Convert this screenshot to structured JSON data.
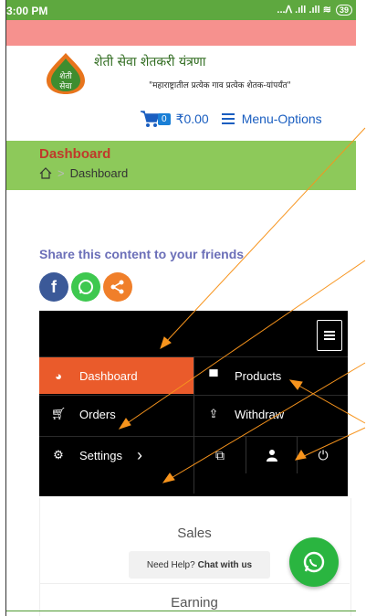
{
  "status_bar": {
    "time": "3:00 PM",
    "battery": "39",
    "signal_icons": "...ᐱ .ıll .ıll ≋"
  },
  "header": {
    "logo_text_top": "शेती",
    "logo_text_bottom": "सेवा",
    "brand": "शेती सेवा शेतकरी यंत्रणा",
    "tagline": "\"महाराष्ट्रातील प्रत्येक गाव प्रत्येक शेतक-यांपर्यंत\""
  },
  "cart": {
    "count": "0",
    "price": "₹0.00",
    "menu_label": "Menu-Options"
  },
  "page": {
    "title": "Dashboard",
    "breadcrumb": "Dashboard"
  },
  "share": {
    "title": "Share this content to your friends"
  },
  "menu": {
    "items": [
      {
        "label": "Dashboard",
        "icon": "dashboard-icon"
      },
      {
        "label": "Products",
        "icon": "briefcase-icon"
      },
      {
        "label": "Orders",
        "icon": "cart-icon"
      },
      {
        "label": "Withdraw",
        "icon": "upload-icon"
      },
      {
        "label": "Settings",
        "icon": "gear-icon"
      }
    ],
    "settings_chevron": "›",
    "icon_actions": [
      "external-link-icon",
      "user-icon",
      "power-icon"
    ]
  },
  "body": {
    "sales": "Sales",
    "earning": "Earning"
  },
  "help": {
    "prefix": "Need Help?",
    "link": "Chat with us"
  },
  "colors": {
    "status_green": "#5ea83f",
    "pink": "#f6918e",
    "light_green": "#8dc95a",
    "accent_orange": "#ea5b2b",
    "arrow": "#f7941d",
    "whatsapp": "#2ab540"
  }
}
